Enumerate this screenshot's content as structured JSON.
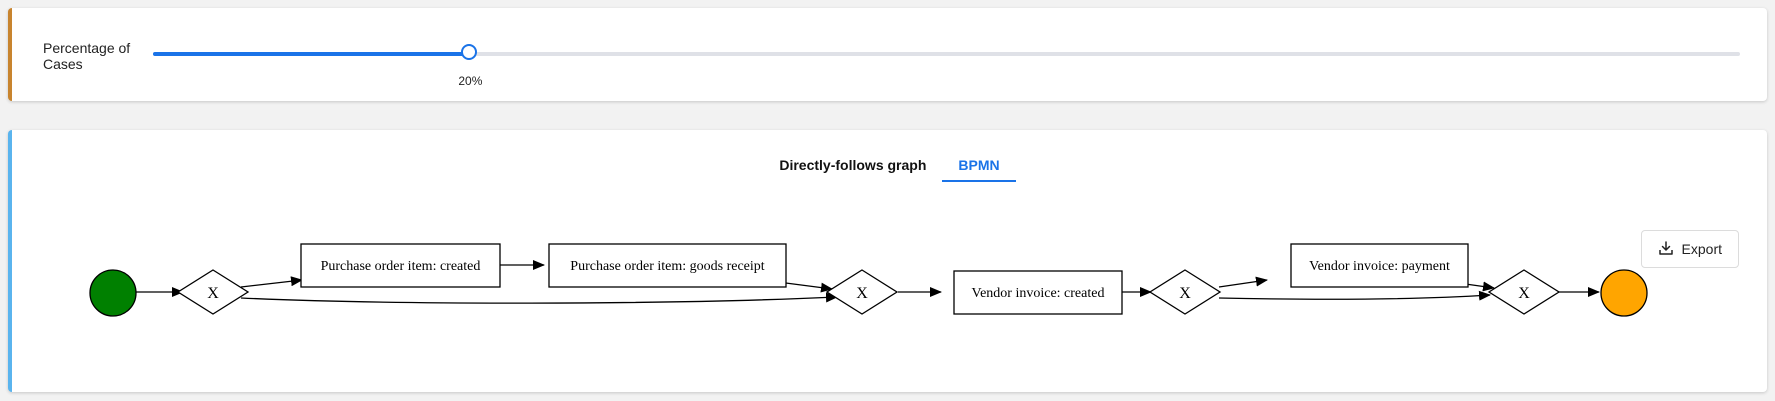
{
  "filter": {
    "label": "Percentage of Cases",
    "value": 20,
    "value_text": "20%"
  },
  "tabs": [
    {
      "label": "Directly-follows graph",
      "active": false
    },
    {
      "label": "BPMN",
      "active": true
    }
  ],
  "export": {
    "label": "Export",
    "icon": "download-icon"
  },
  "bpmn": {
    "gateway_symbol": "X",
    "tasks": [
      "Purchase order item: created",
      "Purchase order item: goods receipt",
      "Vendor invoice: created",
      "Vendor invoice: payment"
    ],
    "colors": {
      "start_event": "#008000",
      "end_event": "#ffa500",
      "accent": "#1a73e8"
    }
  }
}
